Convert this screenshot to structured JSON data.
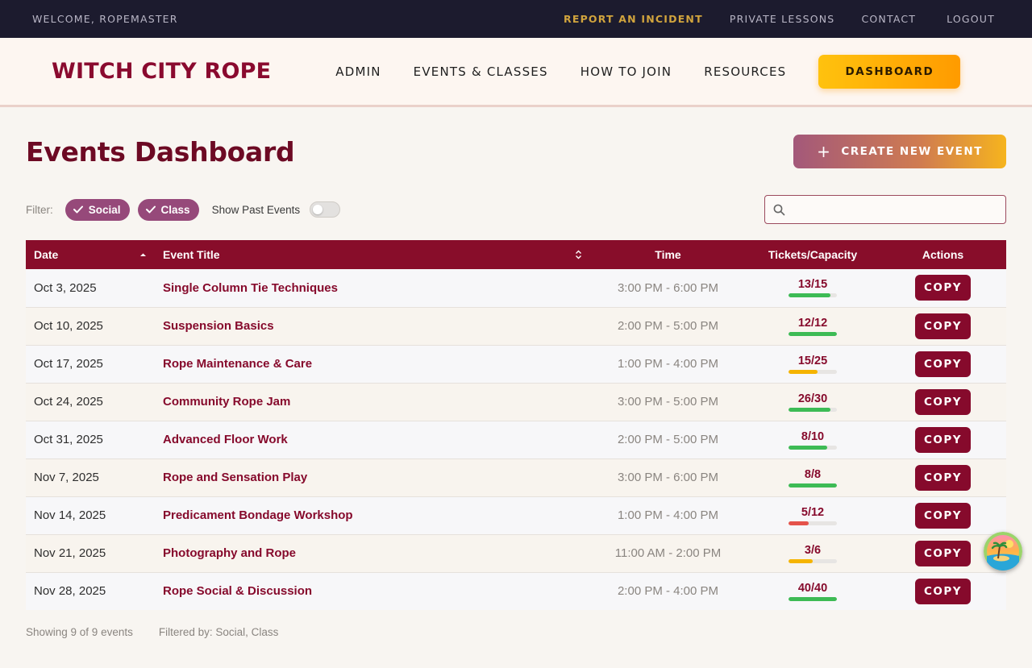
{
  "utility_bar": {
    "welcome": "WELCOME, ROPEMASTER",
    "links": [
      "REPORT AN INCIDENT",
      "PRIVATE LESSONS",
      "CONTACT",
      "LOGOUT"
    ]
  },
  "header": {
    "logo": "WITCH CITY ROPE",
    "nav": [
      "ADMIN",
      "EVENTS & CLASSES",
      "HOW TO JOIN",
      "RESOURCES"
    ],
    "dashboard_button": "DASHBOARD"
  },
  "page": {
    "title": "Events Dashboard",
    "create_button": "CREATE NEW EVENT",
    "create_icon": "plus-icon"
  },
  "filters": {
    "label": "Filter:",
    "chips": [
      "Social",
      "Class"
    ],
    "chip_icon": "checkmark-icon",
    "show_past_label": "Show Past Events",
    "show_past_enabled": false,
    "search_placeholder": "",
    "search_value": "",
    "search_icon": "search-icon"
  },
  "table": {
    "columns": {
      "date": "Date",
      "title": "Event Title",
      "time": "Time",
      "tickets": "Tickets/Capacity",
      "actions": "Actions"
    },
    "sort": {
      "date": "ascending",
      "title": "sortable"
    },
    "copy_label": "COPY",
    "rows": [
      {
        "date": "Oct 3, 2025",
        "title": "Single Column Tie Techniques",
        "time": "3:00 PM - 6:00 PM",
        "tickets": "13/15",
        "fill": 0.87,
        "status": "green"
      },
      {
        "date": "Oct 10, 2025",
        "title": "Suspension Basics",
        "time": "2:00 PM - 5:00 PM",
        "tickets": "12/12",
        "fill": 1.0,
        "status": "green"
      },
      {
        "date": "Oct 17, 2025",
        "title": "Rope Maintenance & Care",
        "time": "1:00 PM - 4:00 PM",
        "tickets": "15/25",
        "fill": 0.6,
        "status": "amber"
      },
      {
        "date": "Oct 24, 2025",
        "title": "Community Rope Jam",
        "time": "3:00 PM - 5:00 PM",
        "tickets": "26/30",
        "fill": 0.87,
        "status": "green"
      },
      {
        "date": "Oct 31, 2025",
        "title": "Advanced Floor Work",
        "time": "2:00 PM - 5:00 PM",
        "tickets": "8/10",
        "fill": 0.8,
        "status": "green"
      },
      {
        "date": "Nov 7, 2025",
        "title": "Rope and Sensation Play",
        "time": "3:00 PM - 6:00 PM",
        "tickets": "8/8",
        "fill": 1.0,
        "status": "green"
      },
      {
        "date": "Nov 14, 2025",
        "title": "Predicament Bondage Workshop",
        "time": "1:00 PM - 4:00 PM",
        "tickets": "5/12",
        "fill": 0.42,
        "status": "red"
      },
      {
        "date": "Nov 21, 2025",
        "title": "Photography and Rope",
        "time": "11:00 AM - 2:00 PM",
        "tickets": "3/6",
        "fill": 0.5,
        "status": "amber"
      },
      {
        "date": "Nov 28, 2025",
        "title": "Rope Social & Discussion",
        "time": "2:00 PM - 4:00 PM",
        "tickets": "40/40",
        "fill": 1.0,
        "status": "green"
      }
    ]
  },
  "footer": {
    "showing": "Showing 9 of 9 events",
    "filtered_by": "Filtered by: Social, Class"
  },
  "status_colors": {
    "green": "#3dbb55",
    "amber": "#f5b400",
    "red": "#e5534b"
  },
  "colors": {
    "brand": "#860a2c",
    "accent": "#ffb300",
    "chip": "#96497a"
  },
  "floating_widget": {
    "icon": "beach-avatar-icon"
  }
}
